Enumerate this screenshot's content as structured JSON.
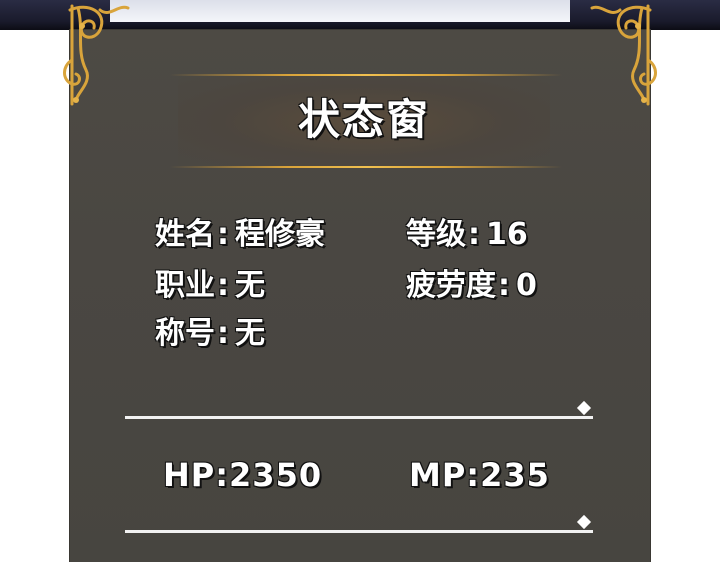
{
  "window": {
    "title": "状态窗"
  },
  "stats": {
    "name": {
      "label": "姓名",
      "value": "程修豪"
    },
    "level": {
      "label": "等级",
      "value": "16"
    },
    "job": {
      "label": "职业",
      "value": "无"
    },
    "fatigue": {
      "label": "疲劳度",
      "value": "0"
    },
    "honor_title": {
      "label": "称号",
      "value": "无"
    }
  },
  "vitals": {
    "hp": {
      "label": "HP",
      "value": "2350"
    },
    "mp": {
      "label": "MP",
      "value": "235"
    }
  },
  "separator": ":",
  "colors": {
    "panel": "#4a4742",
    "gold_accent": "#d9a33a",
    "text": "#ffffff"
  },
  "icons": {
    "corner_ornament": "gold-filigree-corner",
    "divider_marker": "diamond"
  }
}
